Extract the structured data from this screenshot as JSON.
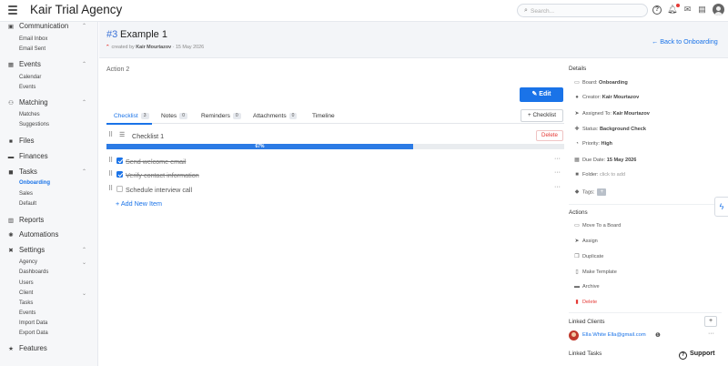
{
  "app": {
    "title": "Kair Trial Agency"
  },
  "search": {
    "placeholder": "Search..."
  },
  "sidebar": {
    "sections": [
      {
        "label": "Communication",
        "icon": "chat-icon",
        "items": [
          "Email Inbox",
          "Email Sent"
        ]
      },
      {
        "label": "Events",
        "icon": "calendar-icon",
        "items": [
          "Calendar",
          "Events"
        ]
      },
      {
        "label": "Matching",
        "icon": "people-icon",
        "items": [
          "Matches",
          "Suggestions"
        ]
      },
      {
        "label": "Files",
        "icon": "folder-icon",
        "items": []
      },
      {
        "label": "Finances",
        "icon": "wallet-icon",
        "items": []
      },
      {
        "label": "Tasks",
        "icon": "briefcase-icon",
        "items": [
          "Onboarding",
          "Sales",
          "Default"
        ],
        "active_item": "Onboarding"
      },
      {
        "label": "Reports",
        "icon": "chart-icon",
        "items": []
      },
      {
        "label": "Automations",
        "icon": "cogs-icon",
        "items": []
      },
      {
        "label": "Settings",
        "icon": "tools-icon",
        "items": [
          "Agency",
          "Dashboards",
          "Users",
          "Client",
          "Tasks",
          "Events",
          "Import Data",
          "Export Data"
        ]
      },
      {
        "label": "Features",
        "icon": "star-icon",
        "items": []
      }
    ]
  },
  "task": {
    "number": "#3",
    "name": "Example 1",
    "created_prefix": "created by",
    "created_by": "Kair Mourtazov",
    "created_date": "15 May 2026",
    "back_label": "Back to Onboarding",
    "action_label": "Action 2",
    "edit_label": "Edit"
  },
  "tabs": [
    {
      "label": "Checklist",
      "count": "3"
    },
    {
      "label": "Notes",
      "count": "0"
    },
    {
      "label": "Reminders",
      "count": "0"
    },
    {
      "label": "Attachments",
      "count": "0"
    },
    {
      "label": "Timeline",
      "count": ""
    }
  ],
  "add_checklist_label": "Checklist",
  "checklist": {
    "title": "Checklist 1",
    "delete_label": "Delete",
    "progress_percent": 67,
    "progress_text": "67%",
    "items": [
      {
        "label": "Send welcome email",
        "done": true
      },
      {
        "label": "Verify contact information",
        "done": true
      },
      {
        "label": "Schedule interview call",
        "done": false
      }
    ],
    "add_item_label": "Add New Item"
  },
  "details": {
    "title": "Details",
    "board_label": "Board:",
    "board_value": "Onboarding",
    "creator_label": "Creator:",
    "creator_value": "Kair Mourtazov",
    "assigned_label": "Assigned To:",
    "assigned_value": "Kair Mourtazov",
    "status_label": "Status:",
    "status_value": "Background Check",
    "priority_label": "Priority:",
    "priority_value": "High",
    "due_label": "Due Date:",
    "due_value": "15 May 2026",
    "folder_label": "Folder:",
    "folder_value": "click to add",
    "tags_label": "Tags:",
    "tags_add": "+"
  },
  "actions": {
    "title": "Actions",
    "move": "Move To a Board",
    "assign": "Assign",
    "duplicate": "Duplicate",
    "template": "Make Template",
    "archive": "Archive",
    "delete": "Delete"
  },
  "linked_clients": {
    "title": "Linked Clients",
    "add": "+",
    "client_name": "Ella White Ella@gmail.com"
  },
  "linked_tasks": {
    "title": "Linked Tasks"
  },
  "support": {
    "label": "Support"
  },
  "colors": {
    "accent": "#1a73e8",
    "danger": "#e53935",
    "sidebar_bg": "#f6f7f9"
  }
}
